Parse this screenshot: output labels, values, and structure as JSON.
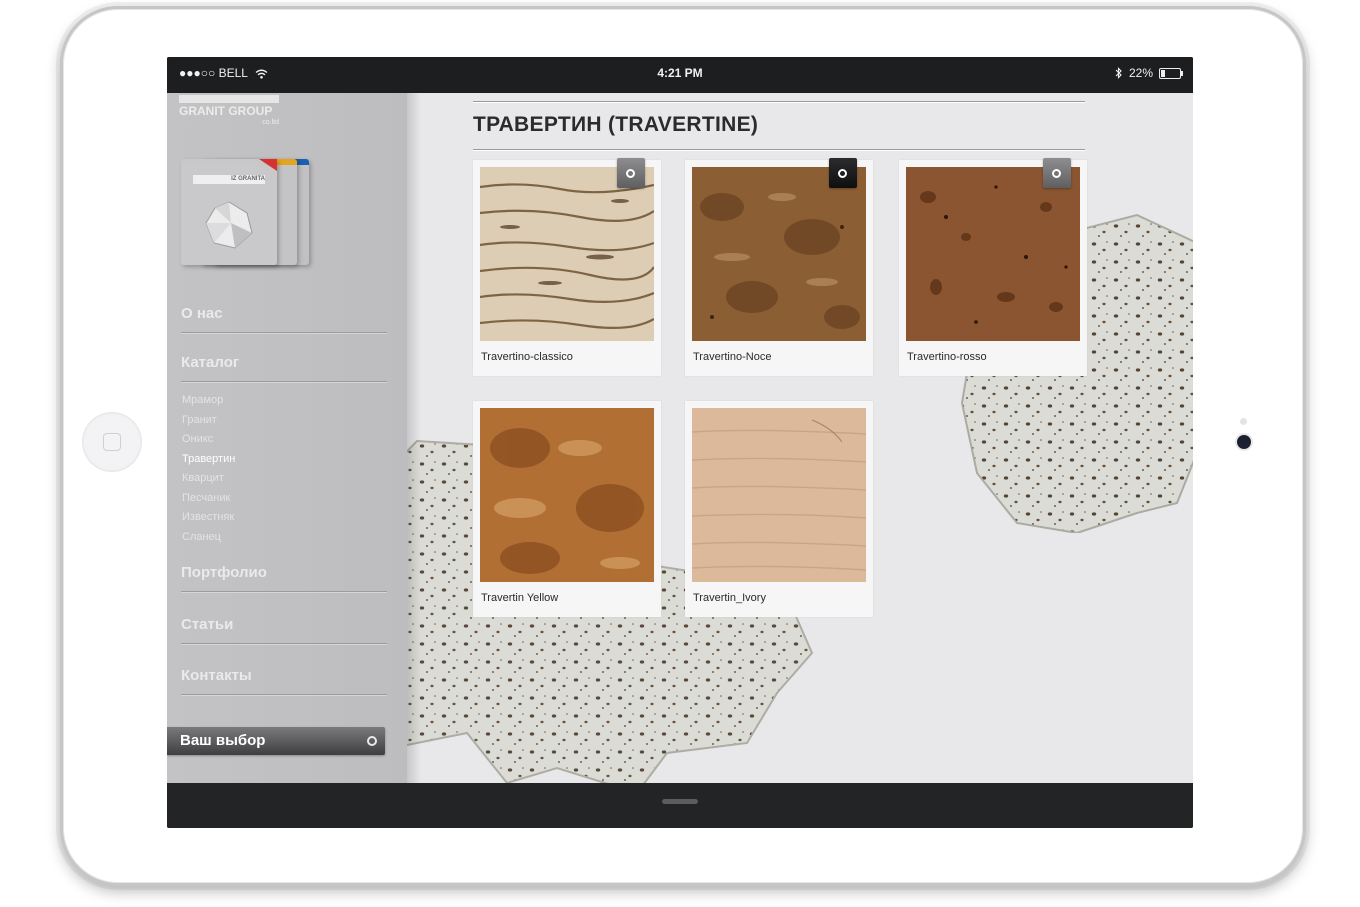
{
  "status_bar": {
    "carrier": "●●●○○ BELL",
    "time": "4:21 PM",
    "battery": "22%"
  },
  "sidebar": {
    "logo": {
      "name": "GRANIT GROUP",
      "suffix": "co.ltd"
    },
    "catalog_book_label": "IZ GRANITA",
    "nav": [
      {
        "label": "О нас"
      },
      {
        "label": "Каталог"
      },
      {
        "label": "Портфолио"
      },
      {
        "label": "Статьи"
      },
      {
        "label": "Контакты"
      }
    ],
    "catalog_items": [
      "Мрамор",
      "Гранит",
      "Оникс",
      "Травертин",
      "Кварцит",
      "Песчаник",
      "Известняк",
      "Сланец"
    ],
    "active_catalog_item": "Травертин",
    "choice_button": "Ваш выбор"
  },
  "main": {
    "title": "ТРАВЕРТИН (TRAVERTINE)",
    "products": [
      {
        "name": "Travertino-classico",
        "selected": false,
        "toggle_shown": true
      },
      {
        "name": "Travertino-Noce",
        "selected": true,
        "toggle_shown": true
      },
      {
        "name": "Travertino-rosso",
        "selected": false,
        "toggle_shown": true
      },
      {
        "name": "Travertin Yellow",
        "selected": false,
        "toggle_shown": false
      },
      {
        "name": "Travertin_Ivory",
        "selected": false,
        "toggle_shown": false
      }
    ]
  },
  "colors": {
    "sidebar": "#c0c0c2",
    "content_bg": "#e8e8eb",
    "title": "#2b2b2d",
    "bars": "#1d1e20"
  }
}
